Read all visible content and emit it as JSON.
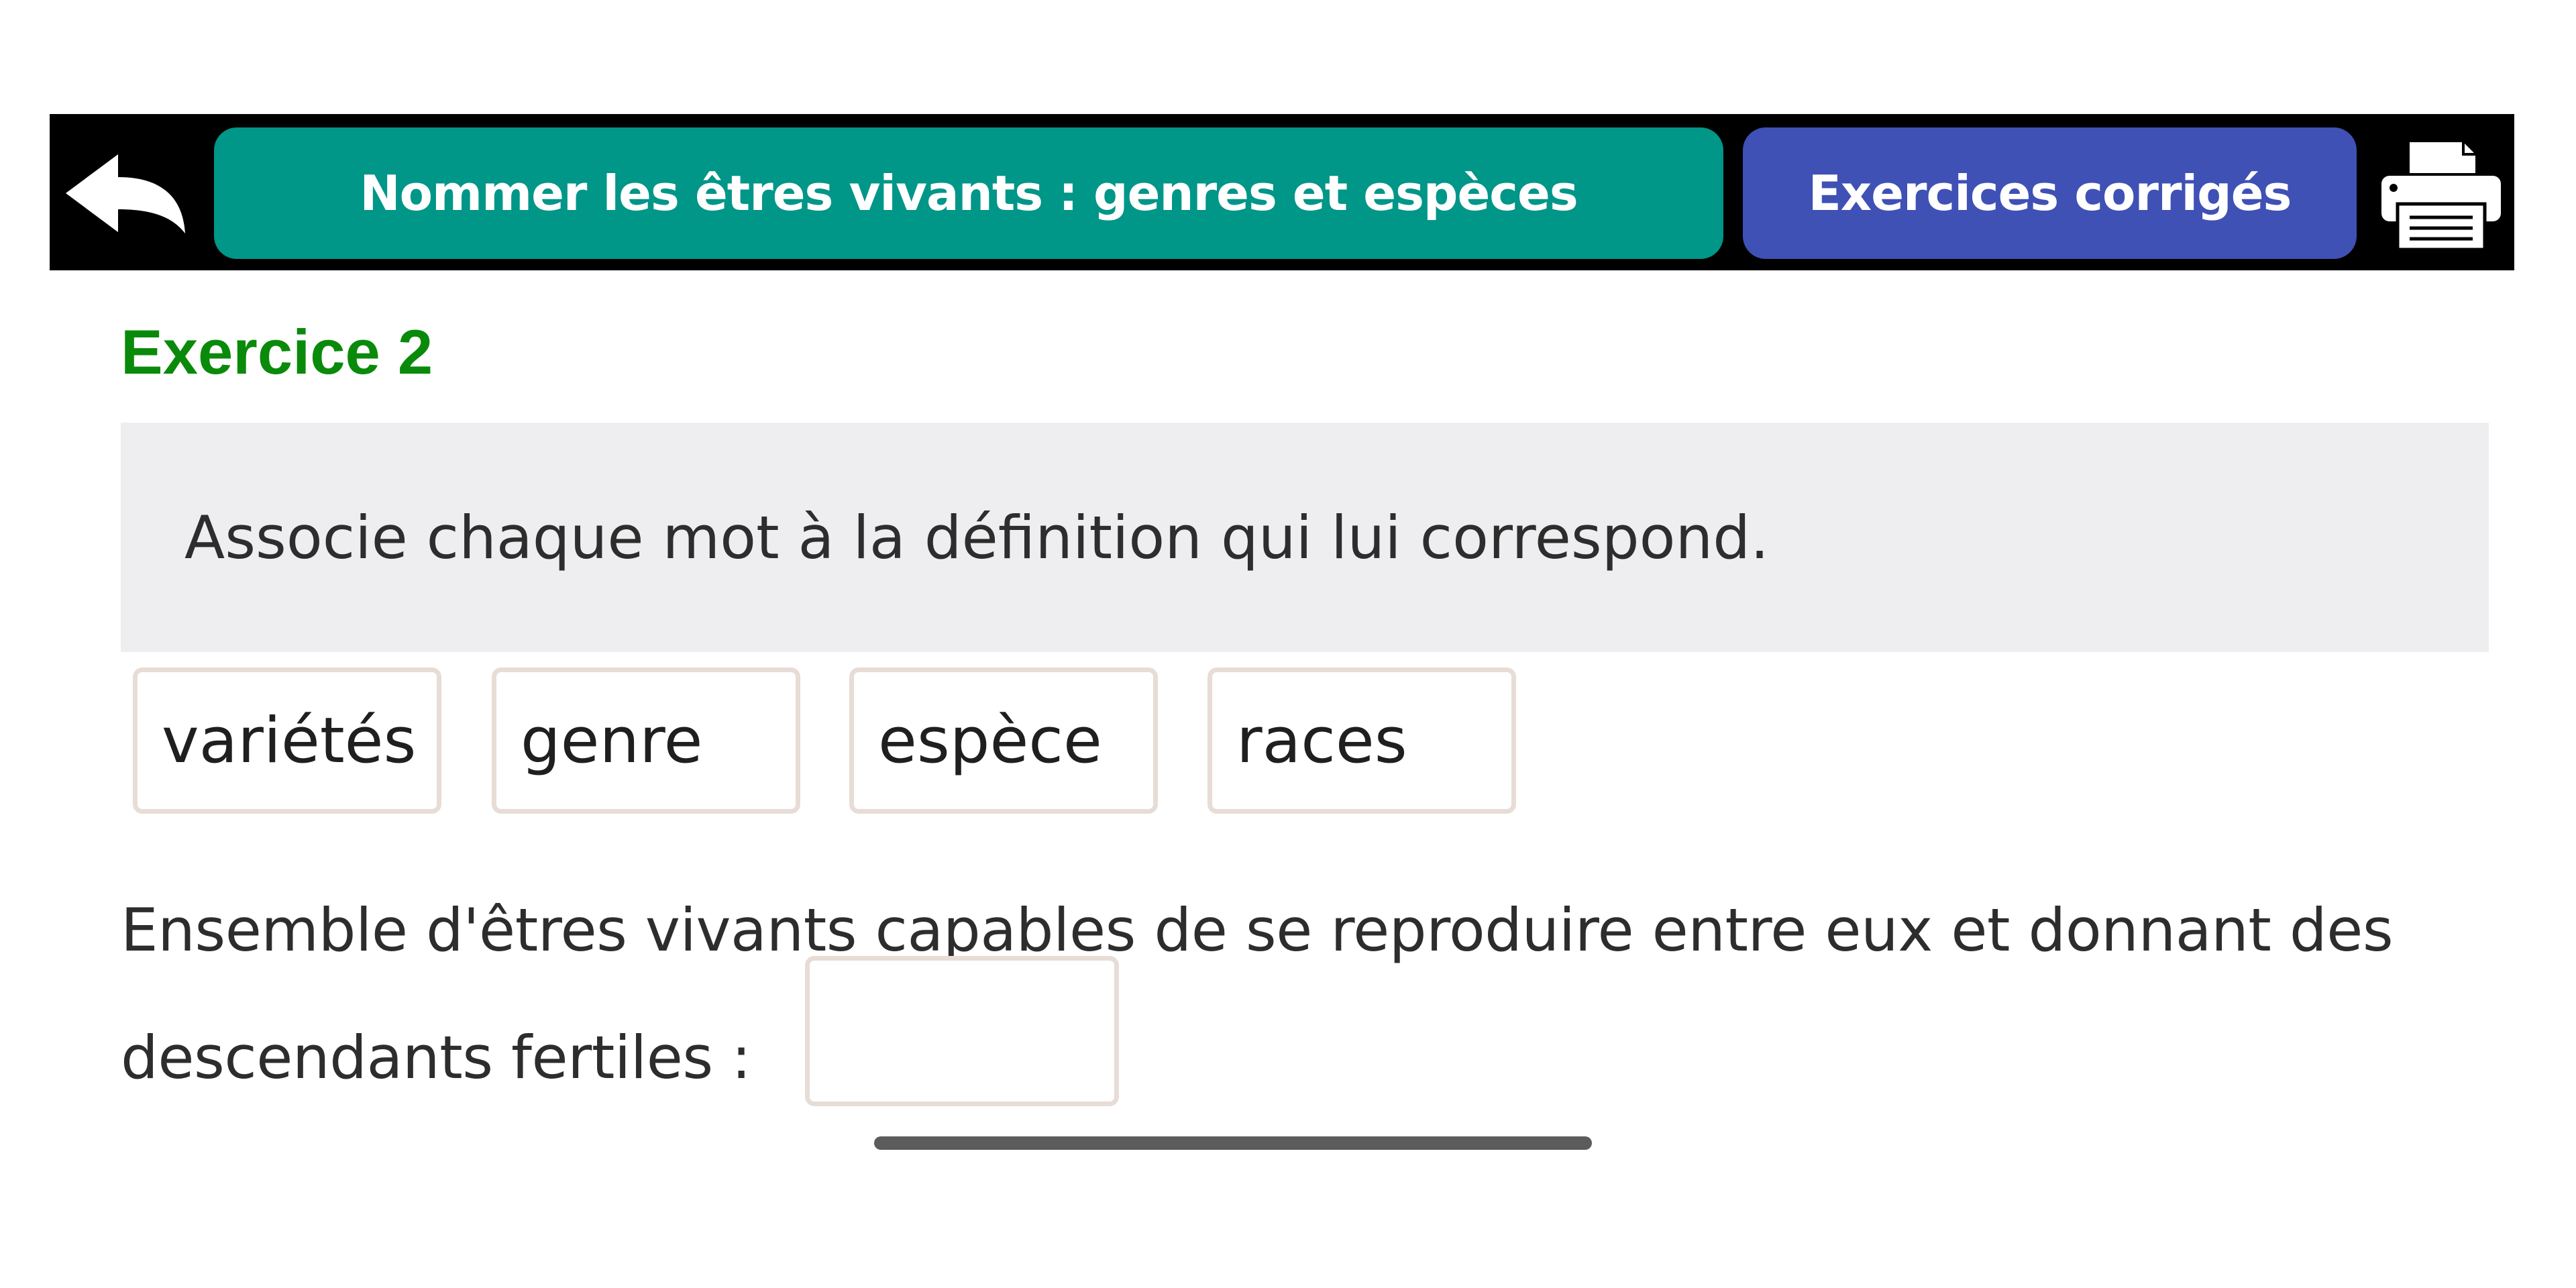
{
  "header": {
    "back_icon": "back-arrow-icon",
    "title": "Nommer les êtres vivants : genres et espèces",
    "exercises_label": "Exercices corrigés",
    "print_icon": "printer-icon",
    "colors": {
      "bar": "#000000",
      "title_pill": "#009688",
      "exercises_pill": "#3f51b5"
    }
  },
  "exercise": {
    "title": "Exercice 2",
    "title_color": "#0a8a0a",
    "instruction": "Associe chaque mot à la définition qui lui correspond.",
    "words": [
      "variétés",
      "genre",
      "espèce",
      "races"
    ],
    "definition_line1": "Ensemble d'êtres vivants capables de se reproduire entre eux et donnant des",
    "definition_line2": "descendants fertiles :",
    "answer": ""
  }
}
